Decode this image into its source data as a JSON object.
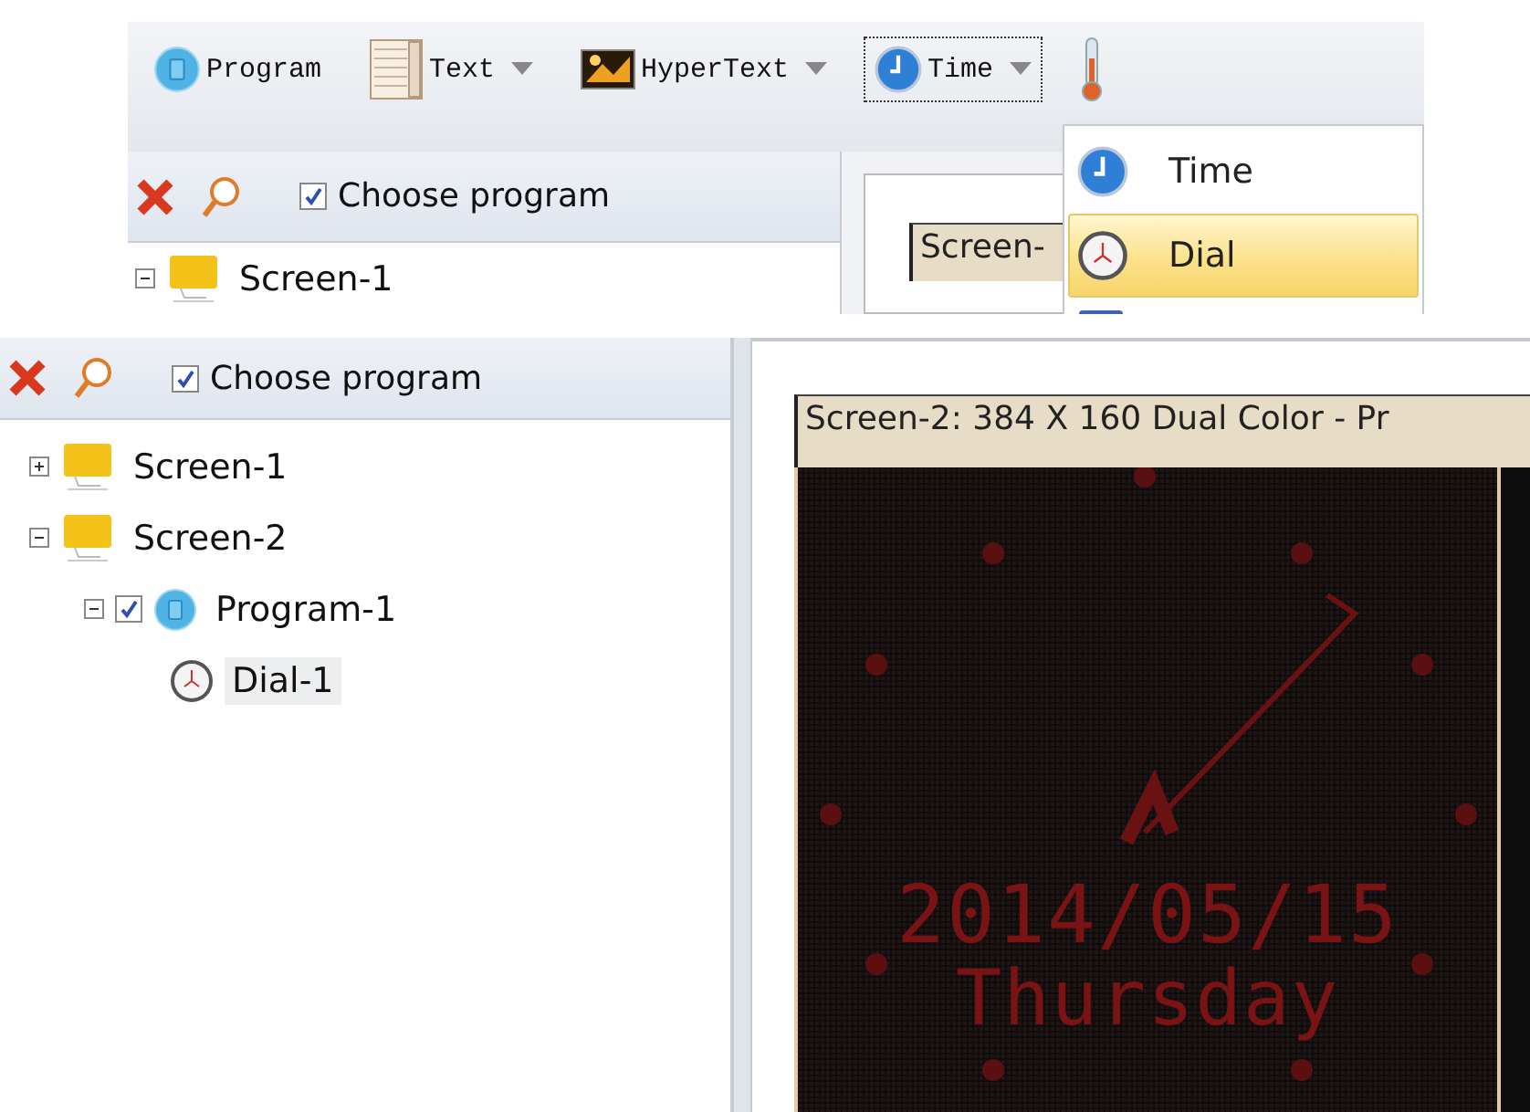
{
  "top": {
    "toolbar": [
      {
        "kind": "program",
        "label": "Program",
        "dropdown": false,
        "focused": false
      },
      {
        "kind": "text",
        "label": "Text",
        "dropdown": true,
        "focused": false
      },
      {
        "kind": "hypertext",
        "label": "HyperText",
        "dropdown": true,
        "focused": false
      },
      {
        "kind": "time",
        "label": "Time",
        "dropdown": true,
        "focused": true
      },
      {
        "kind": "thermometer",
        "dropdown": false,
        "focused": false
      }
    ],
    "panel": {
      "choose_program": {
        "label": "Choose program",
        "checked": true
      },
      "tree": [
        {
          "kind": "screen",
          "label": "Screen-1",
          "expanded": true,
          "selected": false
        }
      ]
    },
    "preview_title": "Screen-",
    "menu": [
      {
        "kind": "time",
        "label": "Time",
        "selected": false
      },
      {
        "kind": "dial",
        "label": "Dial",
        "selected": true
      },
      {
        "kind": "calendar",
        "selected": false
      }
    ]
  },
  "bottom": {
    "panel": {
      "choose_program": {
        "label": "Choose program",
        "checked": true
      },
      "tree": [
        {
          "kind": "screen",
          "label": "Screen-1",
          "expanded": false,
          "selected": false
        },
        {
          "kind": "screen",
          "label": "Screen-2",
          "expanded": true,
          "selected": false,
          "children": [
            {
              "kind": "program",
              "label": "Program-1",
              "expanded": true,
              "checked": true,
              "selected": false,
              "children": [
                {
                  "kind": "dial",
                  "label": "Dial-1",
                  "selected": true
                }
              ]
            }
          ]
        }
      ]
    },
    "preview": {
      "title": "Screen-2: 384 X 160 Dual Color - Pr",
      "led_lines": [
        "2014/05/15",
        "Thursday"
      ]
    }
  }
}
